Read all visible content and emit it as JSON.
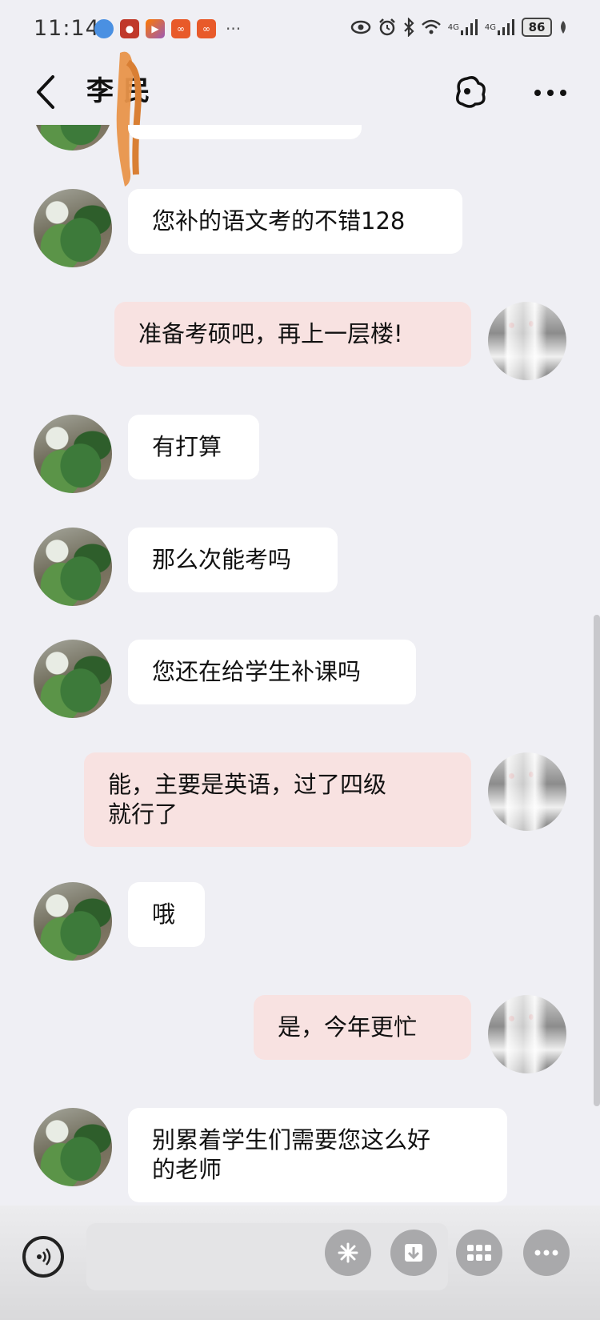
{
  "status_bar": {
    "time": "11:14",
    "battery": "86",
    "network_1": "4G",
    "network_2": "4G",
    "more": "···"
  },
  "navbar": {
    "title": "李 民"
  },
  "messages": [
    {
      "side": "in",
      "text": "您补的语文考的不错128"
    },
    {
      "side": "out",
      "text": "准备考硕吧，再上一层楼!"
    },
    {
      "side": "in",
      "text": "有打算"
    },
    {
      "side": "in",
      "text": "那么次能考吗"
    },
    {
      "side": "in",
      "text": "您还在给学生补课吗"
    },
    {
      "side": "out",
      "text": "能，主要是英语，过了四级\n就行了"
    },
    {
      "side": "in",
      "text": "哦"
    },
    {
      "side": "out",
      "text": "是，今年更忙"
    },
    {
      "side": "in",
      "text": "别累着学生们需要您这么好\n的老师"
    }
  ],
  "input": {
    "placeholder": ""
  },
  "colors": {
    "background": "#efeff4",
    "incoming_bubble": "#ffffff",
    "outgoing_bubble": "#f8e2e1"
  }
}
